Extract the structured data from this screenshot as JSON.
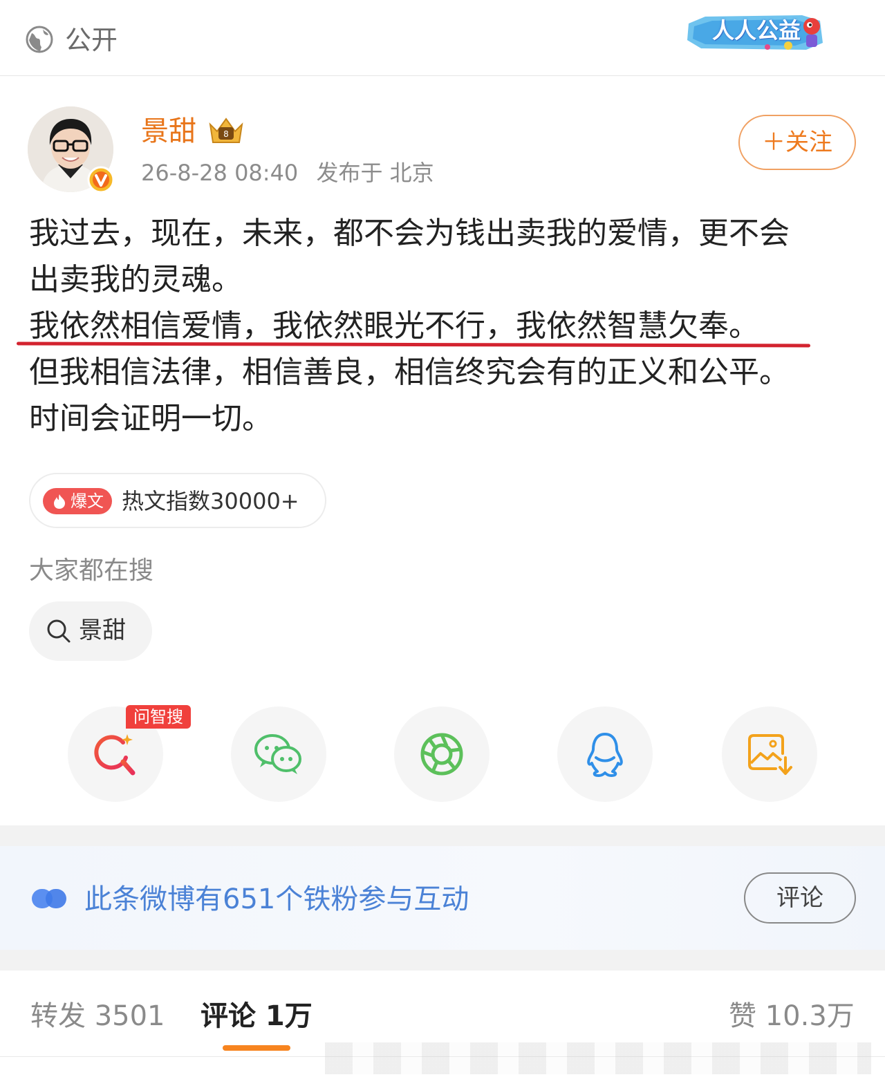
{
  "header": {
    "privacy_label": "公开",
    "charity_label": "人人公益"
  },
  "post": {
    "author": "景甜",
    "timestamp": "26-8-28 08:40",
    "location": "发布于 北京",
    "follow_label": "＋关注",
    "lines": [
      "我过去，现在，未来，都不会为钱出卖我的爱情，更不会",
      "出卖我的灵魂。",
      "我依然相信爱情，我依然眼光不行，我依然智慧欠奉。",
      "但我相信法律，相信善良，相信终究会有的正义和公平。",
      "时间会证明一切。"
    ],
    "hot_tag": "爆文",
    "hot_index": "热文指数30000+"
  },
  "search": {
    "title": "大家都在搜",
    "chip": "景甜"
  },
  "share": {
    "ai_tag": "问智搜",
    "icons": [
      "ai-search-icon",
      "wechat-icon",
      "moments-icon",
      "qq-icon",
      "save-image-icon"
    ]
  },
  "fans_banner": {
    "text": "此条微博有651个铁粉参与互动",
    "button": "评论"
  },
  "tabs": {
    "repost": "转发 3501",
    "comment": "评论 1万",
    "like": "赞 10.3万"
  },
  "colors": {
    "accent": "#ee7a1e",
    "underline": "#d3232f",
    "link_blue": "#4b82d6"
  }
}
